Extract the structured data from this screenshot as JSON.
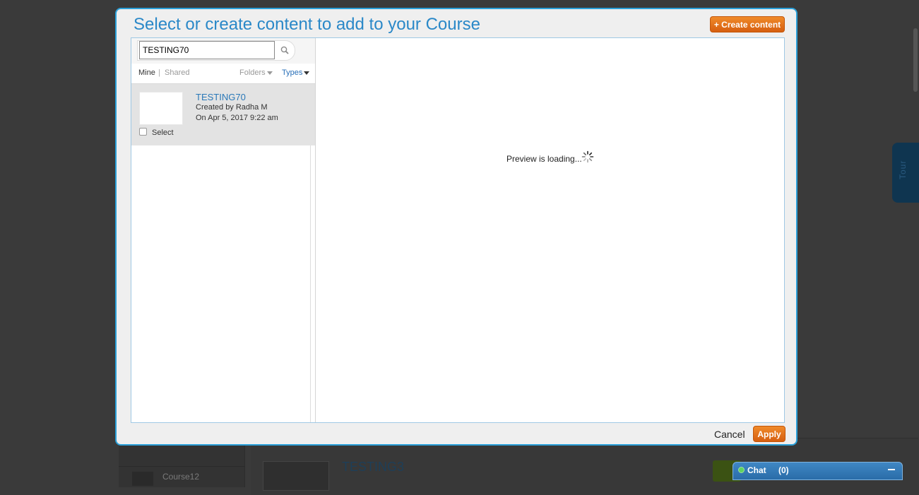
{
  "background": {
    "course_item": "Course12",
    "item_title": "TESTING3",
    "tour_label": "Tour"
  },
  "modal": {
    "title": "Select or create content to add to your Course",
    "create_button": "+ Create content",
    "search": {
      "value": "TESTING70"
    },
    "filters": {
      "mine": "Mine",
      "separator": "|",
      "shared": "Shared",
      "folders": "Folders",
      "types": "Types"
    },
    "results": [
      {
        "title": "TESTING70",
        "created_by": "Created by Radha M",
        "date": "On Apr 5, 2017 9:22 am",
        "select_label": "Select"
      }
    ],
    "preview": {
      "status": "Preview is loading..."
    },
    "cancel_button": "Cancel",
    "apply_button": "Apply"
  },
  "chat": {
    "label": "Chat",
    "count": "(0)"
  },
  "colors": {
    "accent": "#2a88c8",
    "button": "#e8741c",
    "overlay": "#3a3a3a"
  }
}
